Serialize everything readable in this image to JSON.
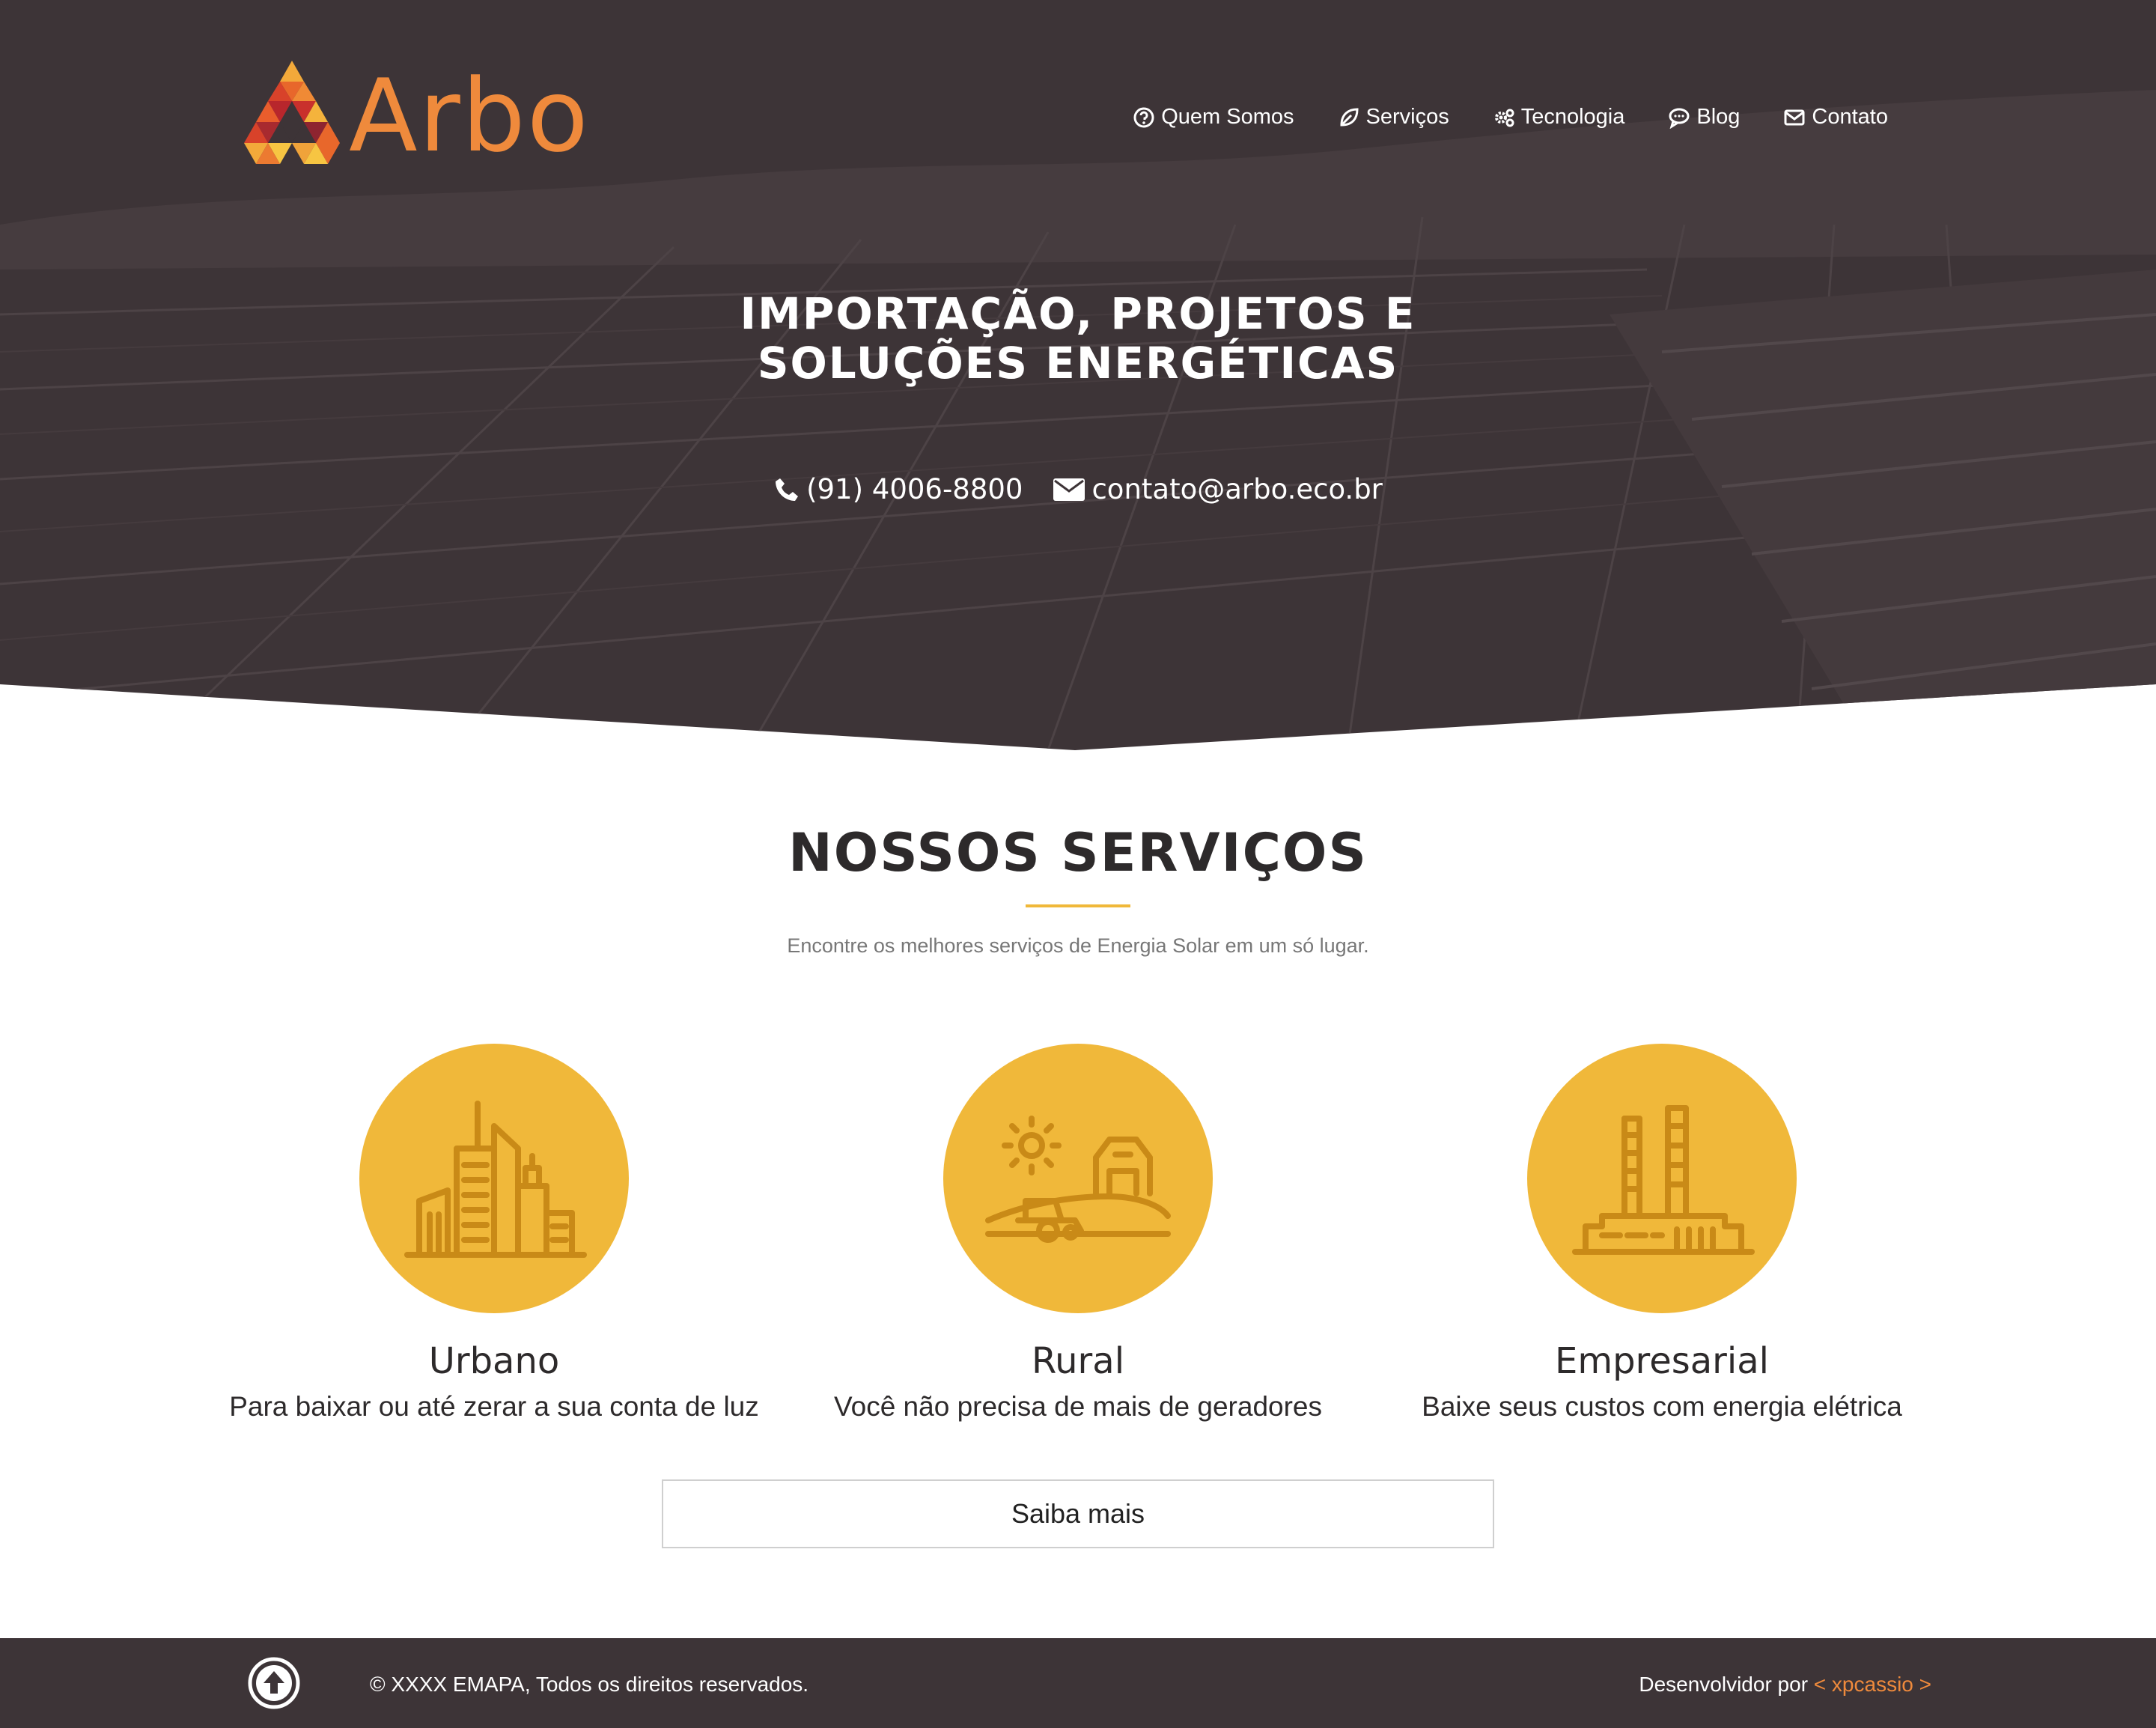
{
  "brand": {
    "name": "Arbo",
    "accent_color": "#ef8a3c",
    "dark_color": "#3d3437",
    "highlight_color": "#f0b83a"
  },
  "nav": {
    "items": [
      {
        "label": "Quem Somos",
        "icon": "question-circle-icon"
      },
      {
        "label": "Serviços",
        "icon": "leaf-icon"
      },
      {
        "label": "Tecnologia",
        "icon": "gears-icon"
      },
      {
        "label": "Blog",
        "icon": "chat-bubble-icon"
      },
      {
        "label": "Contato",
        "icon": "envelope-icon"
      }
    ]
  },
  "hero": {
    "title_line1": "IMPORTAÇÃO, PROJETOS E",
    "title_line2": "SOLUÇÕES ENERGÉTICAS",
    "phone": "(91) 4006-8800",
    "email": "contato@arbo.eco.br"
  },
  "services": {
    "title": "NOSSOS SERVIÇOS",
    "subtitle": "Encontre os melhores serviços de Energia Solar em um só lugar.",
    "cards": [
      {
        "title": "Urbano",
        "description": "Para baixar ou até zerar a sua conta de luz",
        "icon": "city-buildings-icon"
      },
      {
        "title": "Rural",
        "description": "Você não precisa de mais de geradores",
        "icon": "farm-barn-icon"
      },
      {
        "title": "Empresarial",
        "description": "Baixe seus custos com energia elétrica",
        "icon": "factory-icon"
      }
    ],
    "button_label": "Saiba mais"
  },
  "footer": {
    "copyright": "© XXXX EMAPA, Todos os direitos reservados.",
    "dev_prefix": "Desenvolvidor por ",
    "dev_link": "< xpcassio >"
  }
}
